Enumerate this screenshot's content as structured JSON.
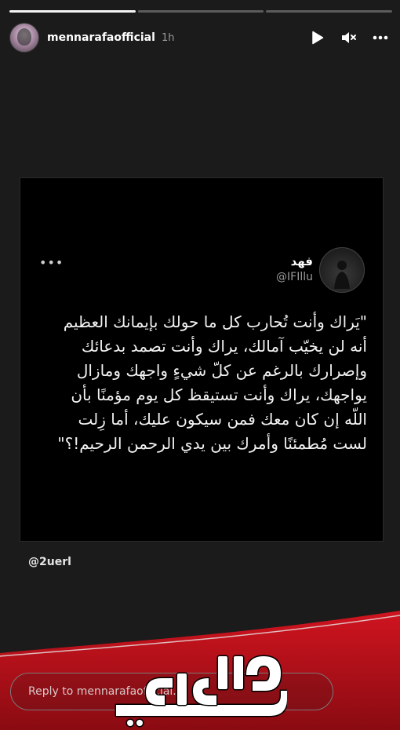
{
  "story": {
    "progress": [
      1.0,
      0.0,
      0.0
    ],
    "username": "mennarafaofficial",
    "time": "1h"
  },
  "icons": {
    "play": "play-icon",
    "mute": "speaker-muted-icon",
    "more": "more-horizontal-icon"
  },
  "tweet": {
    "name": "فهد",
    "handle": "@IFIllu",
    "more": "•••",
    "lines": [
      "\"يَراك وأنت تُحارب كل ما حولك بإيمانك العظيم",
      "أنه لن يخيّب آمالك، يراك وأنت تصمد بدعائك",
      "وإصرارك بالرغم عن كلّ شيءٍ واجهك ومازال",
      "يواجهك، يراك وأنت تستيقظ كل يوم مؤمنًا بأن",
      "اللّه إن كان معك فمن سيكون عليك، أما زِلت",
      "لست مُطمئنًا وأمرك بين يدي الرحمن الرحيم!؟\""
    ]
  },
  "credit": "@2uerl",
  "reply": {
    "placeholder": "Reply to mennarafaofficial..."
  },
  "colors": {
    "background": "#1b1b1b",
    "wave_red": "#b3121b",
    "card": "#000000"
  }
}
